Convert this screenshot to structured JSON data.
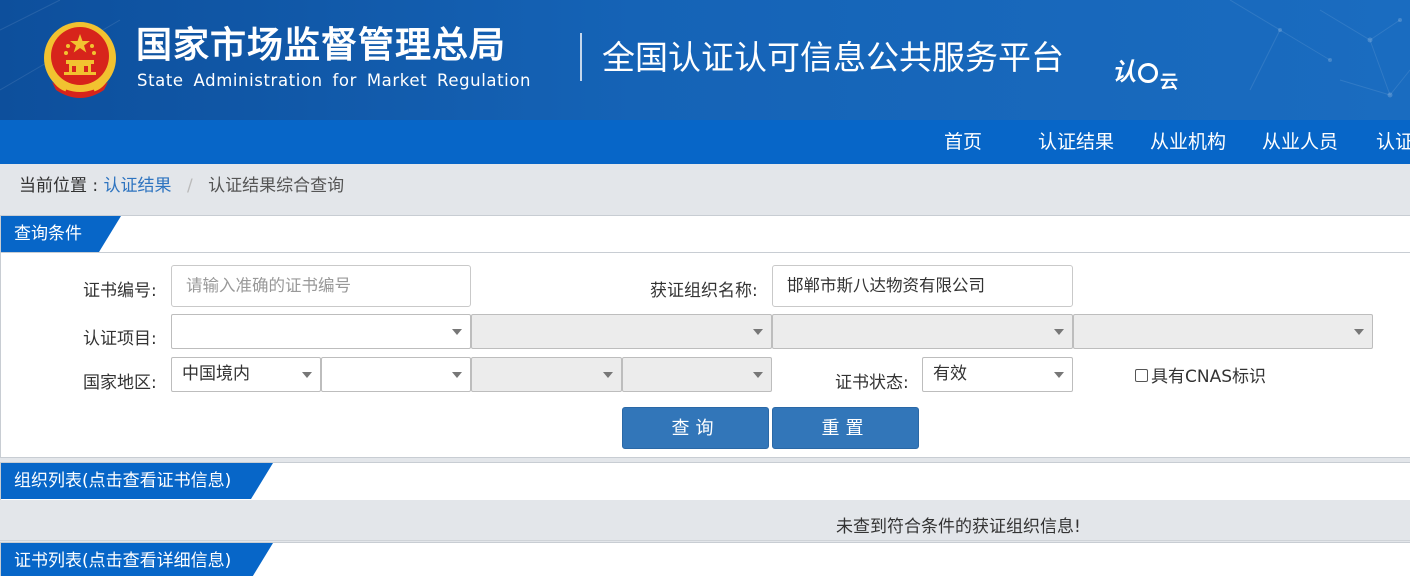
{
  "header": {
    "agency_name_cn": "国家市场监督管理总局",
    "agency_name_en": "State Administration for Market Regulation",
    "platform_title": "全国认证认可信息公共服务平台",
    "logo_text": "认",
    "logo_text2": "云",
    "colors": {
      "banner": "#0d4f9c",
      "nav": "#0766c8",
      "emblem_red": "#d7241b",
      "emblem_gold": "#f2c230"
    }
  },
  "nav": {
    "items": [
      {
        "label": "首页"
      },
      {
        "label": "认证结果"
      },
      {
        "label": "从业机构"
      },
      {
        "label": "从业人员"
      },
      {
        "label": "认证"
      }
    ]
  },
  "breadcrumb": {
    "prefix": "当前位置 :",
    "link": "认证结果",
    "separator": "/",
    "current": "认证结果综合查询"
  },
  "query_panel": {
    "title": "查询条件",
    "cert_no_label": "证书编号:",
    "cert_no_placeholder": "请输入准确的证书编号",
    "org_name_label": "获证组织名称:",
    "org_name_value": "邯郸市斯八达物资有限公司",
    "project_label": "认证项目:",
    "region_label": "国家地区:",
    "region_value": "中国境内",
    "status_label": "证书状态:",
    "status_value": "有效",
    "cnas_label": "具有CNAS标识",
    "search_button": "查询",
    "reset_button": "重置"
  },
  "org_panel": {
    "title": "组织列表(点击查看证书信息)",
    "empty_message": "未查到符合条件的获证组织信息!"
  },
  "cert_panel": {
    "title": "证书列表(点击查看详细信息)"
  }
}
